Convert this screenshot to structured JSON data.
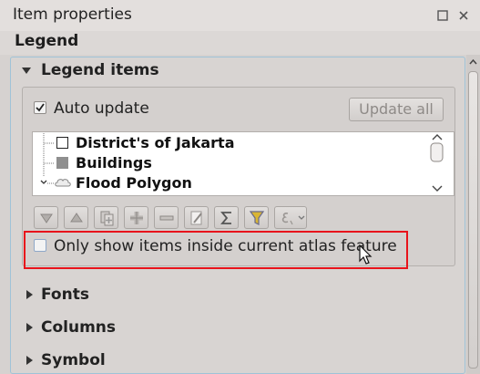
{
  "panel": {
    "title": "Item properties",
    "section_title": "Legend"
  },
  "legend_items": {
    "label": "Legend items",
    "auto_update": {
      "label": "Auto update",
      "checked": true
    },
    "update_all_label": "Update all",
    "tree": [
      {
        "label": "District's of Jakarta",
        "symbol": "empty-square"
      },
      {
        "label": "Buildings",
        "symbol": "gray-square"
      },
      {
        "label": "Flood Polygon",
        "symbol": "cloud-shape"
      }
    ],
    "toolbar_icons": [
      "move-down-icon",
      "move-up-icon",
      "add-group-icon",
      "add-item-icon",
      "remove-item-icon",
      "edit-icon",
      "sum-icon",
      "filter-icon",
      "expression-icon"
    ],
    "only_show_atlas": {
      "label": "Only show items inside current atlas feature",
      "checked": false
    }
  },
  "collapsed_sections": [
    {
      "label": "Fonts"
    },
    {
      "label": "Columns"
    },
    {
      "label": "Symbol"
    }
  ],
  "colors": {
    "highlight_border": "#e8131b",
    "group_border": "#9fc3d7",
    "filter_icon": "#d9b536"
  }
}
